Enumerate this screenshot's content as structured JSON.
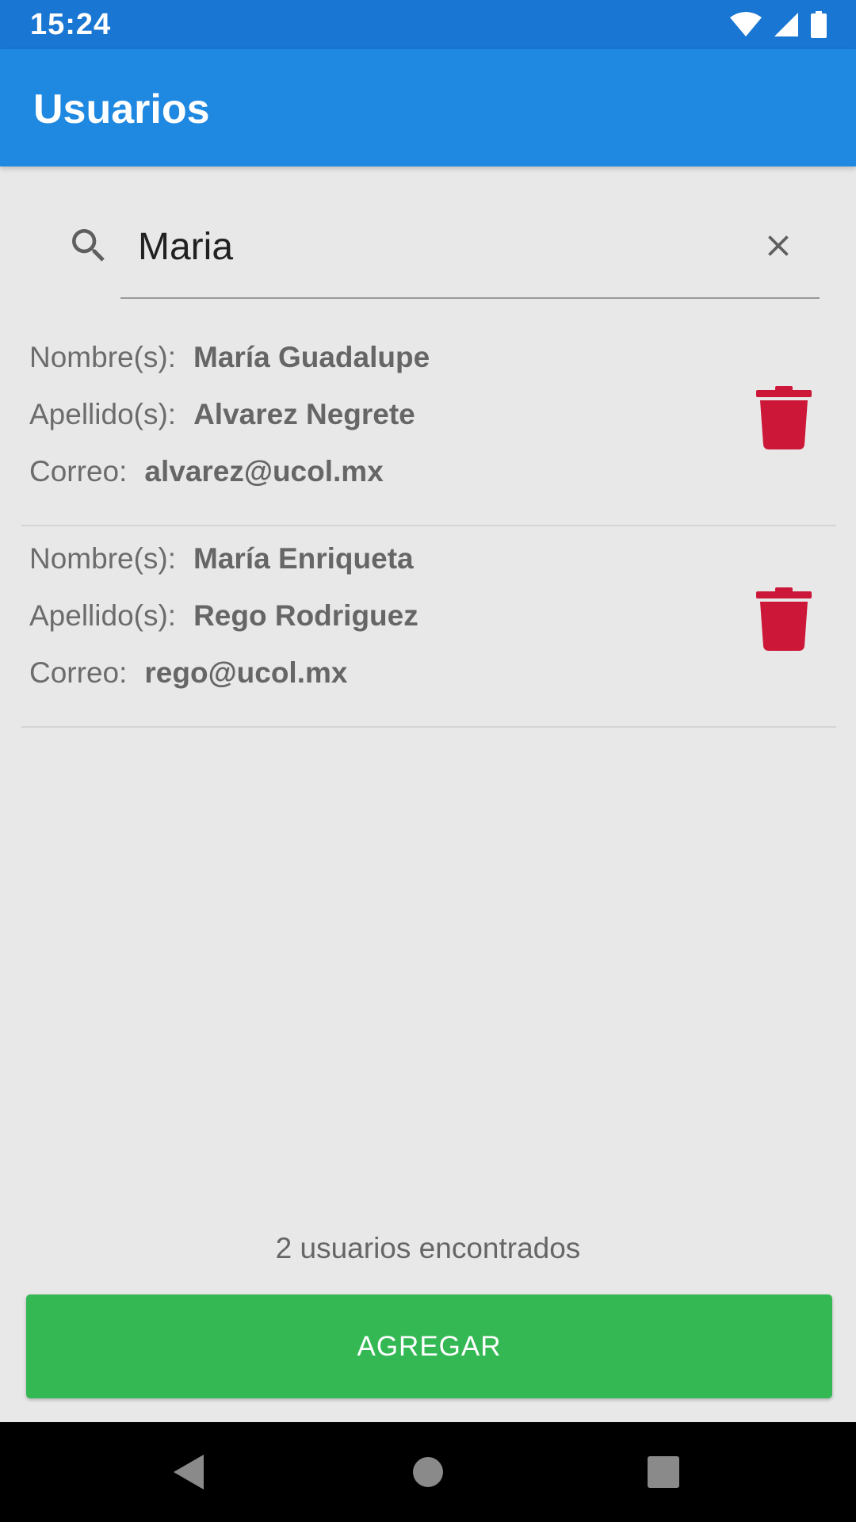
{
  "status_bar": {
    "time": "15:24",
    "icons": [
      "wifi-icon",
      "signal-icon",
      "battery-icon"
    ]
  },
  "app_bar": {
    "title": "Usuarios"
  },
  "search": {
    "value": "Maria",
    "icon": "search-icon",
    "clear_icon": "close-icon"
  },
  "users": [
    {
      "nombre_label": "Nombre(s):",
      "nombre": "María Guadalupe",
      "apellido_label": "Apellido(s):",
      "apellido": "Alvarez Negrete",
      "correo_label": "Correo:",
      "correo": "alvarez@ucol.mx"
    },
    {
      "nombre_label": "Nombre(s):",
      "nombre": "María Enriqueta",
      "apellido_label": "Apellido(s):",
      "apellido": "Rego Rodriguez",
      "correo_label": "Correo:",
      "correo": "rego@ucol.mx"
    }
  ],
  "footer": {
    "result_count": "2 usuarios encontrados",
    "add_label": "AGREGAR"
  },
  "colors": {
    "status_bar": "#1976d2",
    "app_bar": "#1f88e0",
    "background": "#e8e8e8",
    "delete": "#cc1738",
    "add_button": "#33b854"
  },
  "nav_bar": {
    "icons": [
      "back-icon",
      "home-icon",
      "recents-icon"
    ]
  }
}
